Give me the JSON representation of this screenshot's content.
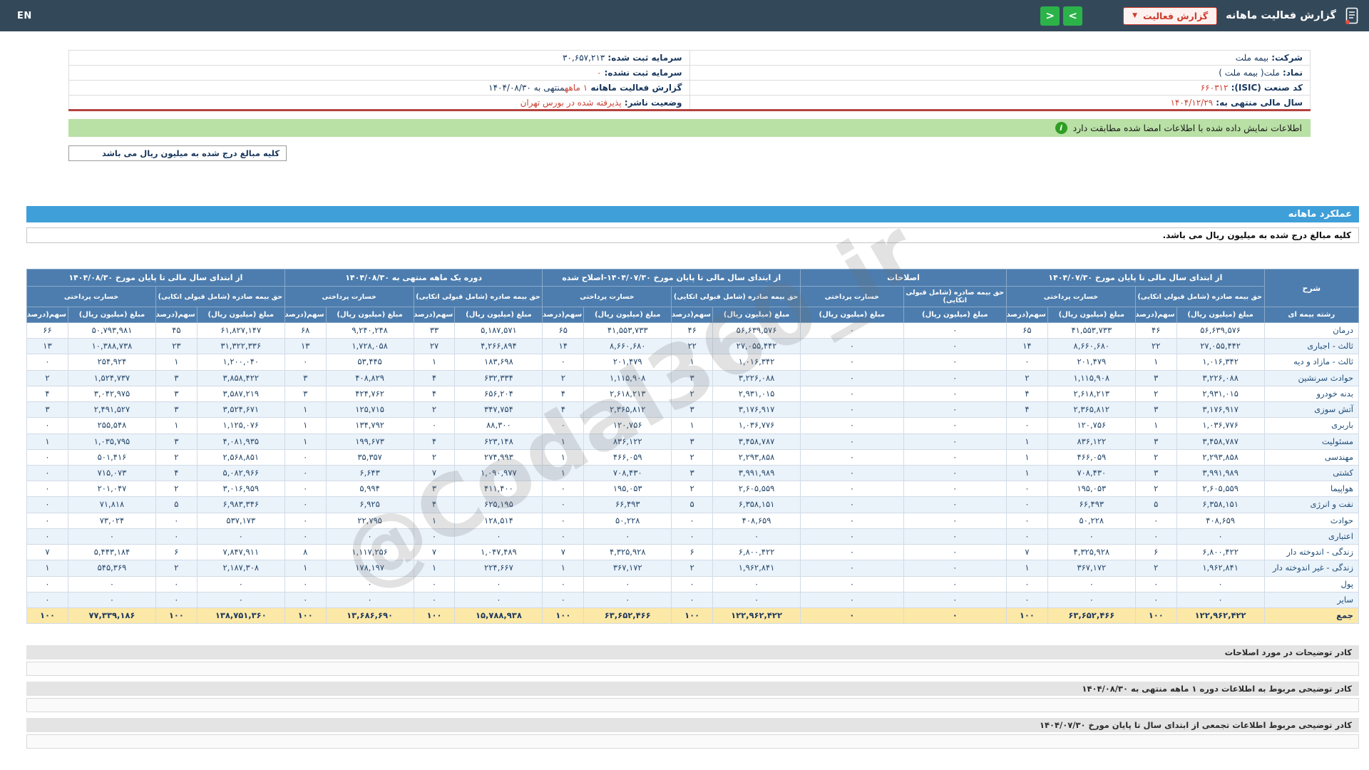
{
  "topbar": {
    "title": "گزارش فعالیت ماهانه",
    "dropdown_label": "گزارش فعالیت",
    "nav_next": ">",
    "nav_prev": "<",
    "en_label": "EN"
  },
  "company_info": {
    "rows": [
      {
        "right": {
          "label": "شرکت:",
          "value": "بیمه ملت",
          "red": false
        },
        "left": {
          "label": "سرمایه ثبت شده:",
          "value": "۳۰,۶۵۷,۲۱۳",
          "red": false
        }
      },
      {
        "right": {
          "label": "نماد:",
          "value": "ملت( بیمه ملت )",
          "red": false
        },
        "left": {
          "label": "سرمایه ثبت نشده:",
          "value": "۰",
          "red": true
        }
      },
      {
        "right": {
          "label": "کد صنعت (ISIC):",
          "value": "۶۶۰۳۱۲",
          "red": true
        },
        "left": {
          "label": "گزارش فعالیت ماهانه",
          "value": "۱ ماهه",
          "suffix": "منتهی به ۱۴۰۴/۰۸/۳۰",
          "red": true
        }
      },
      {
        "right": {
          "label": "سال مالی منتهی به:",
          "value": "۱۴۰۴/۱۲/۲۹",
          "red": true
        },
        "left": {
          "label": "وضعیت ناشر:",
          "value": "پذیرفته شده در بورس تهران",
          "red": true
        }
      }
    ]
  },
  "notice": {
    "text": "اطلاعات نمایش داده شده با اطلاعات امضا شده مطابقت دارد",
    "icon": "i"
  },
  "units_box": "کلیه مبالغ درج شده به میلیون ریال می باشد",
  "section": {
    "title": "عملکرد ماهانه",
    "units_note": "کلیه مبالغ درج شده به میلیون ریال می باشد."
  },
  "table": {
    "headers": {
      "desc": "شرح",
      "line": "رشته بیمه ای",
      "group_ytd_old": "از ابتدای سال مالی تا پایان مورخ ۱۴۰۴/۰۷/۳۰",
      "group_adjustments": "اصلاحات",
      "group_ytd_adjusted": "از ابتدای سال مالی تا پایان مورخ ۱۴۰۴/۰۷/۳۰-اصلاح شده",
      "group_month": "دوره یک ماهه منتهی به ۱۴۰۴/۰۸/۳۰",
      "group_ytd_new": "از ابتدای سال مالی تا پایان مورخ ۱۴۰۴/۰۸/۳۰",
      "sub_premium": "حق بیمه صادره (شامل قبولی اتکایی)",
      "sub_claims": "خسارت پرداختی",
      "leaf_amount": "مبلغ (میلیون ریال)",
      "leaf_share": "سهم(درصد)"
    },
    "rows": [
      {
        "name": "درمان",
        "cells": [
          "۵۶,۶۳۹,۵۷۶",
          "۴۶",
          "۴۱,۵۵۳,۷۳۳",
          "۶۵",
          "۰",
          "۰",
          "۵۶,۶۳۹,۵۷۶",
          "۴۶",
          "۴۱,۵۵۳,۷۳۳",
          "۶۵",
          "۵,۱۸۷,۵۷۱",
          "۳۳",
          "۹,۲۴۰,۲۴۸",
          "۶۸",
          "۶۱,۸۲۷,۱۴۷",
          "۴۵",
          "۵۰,۷۹۳,۹۸۱",
          "۶۶"
        ]
      },
      {
        "name": "ثالث - اجباری",
        "cells": [
          "۲۷,۰۵۵,۴۴۲",
          "۲۲",
          "۸,۶۶۰,۶۸۰",
          "۱۴",
          "۰",
          "۰",
          "۲۷,۰۵۵,۴۴۲",
          "۲۲",
          "۸,۶۶۰,۶۸۰",
          "۱۴",
          "۴,۲۶۶,۸۹۴",
          "۲۷",
          "۱,۷۲۸,۰۵۸",
          "۱۳",
          "۳۱,۳۲۲,۳۳۶",
          "۲۳",
          "۱۰,۳۸۸,۷۳۸",
          "۱۳"
        ]
      },
      {
        "name": "ثالث - مازاد و دیه",
        "cells": [
          "۱,۰۱۶,۳۴۲",
          "۱",
          "۲۰۱,۴۷۹",
          "۰",
          "۰",
          "۰",
          "۱,۰۱۶,۳۴۲",
          "۱",
          "۲۰۱,۴۷۹",
          "۰",
          "۱۸۳,۶۹۸",
          "۱",
          "۵۳,۴۴۵",
          "۰",
          "۱,۲۰۰,۰۴۰",
          "۱",
          "۲۵۴,۹۲۴",
          "۰"
        ]
      },
      {
        "name": "حوادث سرنشین",
        "cells": [
          "۳,۲۲۶,۰۸۸",
          "۳",
          "۱,۱۱۵,۹۰۸",
          "۲",
          "۰",
          "۰",
          "۳,۲۲۶,۰۸۸",
          "۳",
          "۱,۱۱۵,۹۰۸",
          "۲",
          "۶۳۲,۳۳۴",
          "۴",
          "۴۰۸,۸۲۹",
          "۳",
          "۳,۸۵۸,۴۲۲",
          "۳",
          "۱,۵۲۴,۷۳۷",
          "۲"
        ]
      },
      {
        "name": "بدنه خودرو",
        "cells": [
          "۲,۹۳۱,۰۱۵",
          "۲",
          "۲,۶۱۸,۲۱۳",
          "۴",
          "۰",
          "۰",
          "۲,۹۳۱,۰۱۵",
          "۲",
          "۲,۶۱۸,۲۱۳",
          "۴",
          "۶۵۶,۲۰۴",
          "۴",
          "۴۲۴,۷۶۲",
          "۳",
          "۳,۵۸۷,۲۱۹",
          "۳",
          "۳,۰۴۲,۹۷۵",
          "۴"
        ]
      },
      {
        "name": "آتش سوزی",
        "cells": [
          "۳,۱۷۶,۹۱۷",
          "۳",
          "۲,۳۶۵,۸۱۲",
          "۴",
          "۰",
          "۰",
          "۳,۱۷۶,۹۱۷",
          "۳",
          "۲,۳۶۵,۸۱۲",
          "۴",
          "۳۴۷,۷۵۴",
          "۲",
          "۱۲۵,۷۱۵",
          "۱",
          "۳,۵۲۴,۶۷۱",
          "۳",
          "۲,۴۹۱,۵۲۷",
          "۳"
        ]
      },
      {
        "name": "باربری",
        "cells": [
          "۱,۰۳۶,۷۷۶",
          "۱",
          "۱۲۰,۷۵۶",
          "۰",
          "۰",
          "۰",
          "۱,۰۳۶,۷۷۶",
          "۱",
          "۱۲۰,۷۵۶",
          "۰",
          "۸۸,۳۰۰",
          "۰",
          "۱۳۴,۷۹۲",
          "۱",
          "۱,۱۲۵,۰۷۶",
          "۱",
          "۲۵۵,۵۴۸",
          "۰"
        ]
      },
      {
        "name": "مسئولیت",
        "cells": [
          "۳,۴۵۸,۷۸۷",
          "۳",
          "۸۳۶,۱۲۲",
          "۱",
          "۰",
          "۰",
          "۳,۴۵۸,۷۸۷",
          "۳",
          "۸۳۶,۱۲۲",
          "۱",
          "۶۲۳,۱۴۸",
          "۴",
          "۱۹۹,۶۷۳",
          "۱",
          "۴,۰۸۱,۹۳۵",
          "۳",
          "۱,۰۳۵,۷۹۵",
          "۱"
        ]
      },
      {
        "name": "مهندسی",
        "cells": [
          "۲,۲۹۳,۸۵۸",
          "۲",
          "۴۶۶,۰۵۹",
          "۱",
          "۰",
          "۰",
          "۲,۲۹۳,۸۵۸",
          "۲",
          "۴۶۶,۰۵۹",
          "۱",
          "۲۷۴,۹۹۳",
          "۲",
          "۳۵,۳۵۷",
          "۰",
          "۲,۵۶۸,۸۵۱",
          "۲",
          "۵۰۱,۴۱۶",
          "۰"
        ]
      },
      {
        "name": "کشتی",
        "cells": [
          "۳,۹۹۱,۹۸۹",
          "۳",
          "۷۰۸,۴۳۰",
          "۱",
          "۰",
          "۰",
          "۳,۹۹۱,۹۸۹",
          "۳",
          "۷۰۸,۴۳۰",
          "۱",
          "۱,۰۹۰,۹۷۷",
          "۷",
          "۶,۶۴۳",
          "۰",
          "۵,۰۸۲,۹۶۶",
          "۴",
          "۷۱۵,۰۷۳",
          "۰"
        ]
      },
      {
        "name": "هواپیما",
        "cells": [
          "۲,۶۰۵,۵۵۹",
          "۲",
          "۱۹۵,۰۵۳",
          "۰",
          "۰",
          "۰",
          "۲,۶۰۵,۵۵۹",
          "۲",
          "۱۹۵,۰۵۳",
          "۰",
          "۴۱۱,۴۰۰",
          "۳",
          "۵,۹۹۴",
          "۰",
          "۳,۰۱۶,۹۵۹",
          "۲",
          "۲۰۱,۰۴۷",
          "۰"
        ]
      },
      {
        "name": "نفت و انرژی",
        "cells": [
          "۶,۳۵۸,۱۵۱",
          "۵",
          "۶۶,۴۹۳",
          "۰",
          "۰",
          "۰",
          "۶,۳۵۸,۱۵۱",
          "۵",
          "۶۶,۴۹۳",
          "۰",
          "۶۲۵,۱۹۵",
          "۴",
          "۶,۹۲۵",
          "۰",
          "۶,۹۸۳,۳۴۶",
          "۵",
          "۷۱,۸۱۸",
          "۰"
        ]
      },
      {
        "name": "حوادث",
        "cells": [
          "۴۰۸,۶۵۹",
          "۰",
          "۵۰,۲۲۸",
          "۰",
          "۰",
          "۰",
          "۴۰۸,۶۵۹",
          "۰",
          "۵۰,۲۲۸",
          "۰",
          "۱۲۸,۵۱۴",
          "۱",
          "۲۲,۷۹۵",
          "۰",
          "۵۳۷,۱۷۳",
          "۰",
          "۷۳,۰۲۴",
          "۰"
        ]
      },
      {
        "name": "اعتباری",
        "cells": [
          "۰",
          "۰",
          "۰",
          "۰",
          "۰",
          "۰",
          "۰",
          "۰",
          "۰",
          "۰",
          "۰",
          "۰",
          "۰",
          "۰",
          "۰",
          "۰",
          "۰",
          "۰"
        ]
      },
      {
        "name": "زندگی - اندوخته دار",
        "cells": [
          "۶,۸۰۰,۴۲۲",
          "۶",
          "۴,۳۲۵,۹۲۸",
          "۷",
          "۰",
          "۰",
          "۶,۸۰۰,۴۲۲",
          "۶",
          "۴,۳۲۵,۹۲۸",
          "۷",
          "۱,۰۴۷,۴۸۹",
          "۷",
          "۱,۱۱۷,۲۵۶",
          "۸",
          "۷,۸۴۷,۹۱۱",
          "۶",
          "۵,۴۴۳,۱۸۴",
          "۷"
        ]
      },
      {
        "name": "زندگی - غیر اندوخته دار",
        "cells": [
          "۱,۹۶۲,۸۴۱",
          "۲",
          "۳۶۷,۱۷۲",
          "۱",
          "۰",
          "۰",
          "۱,۹۶۲,۸۴۱",
          "۲",
          "۳۶۷,۱۷۲",
          "۱",
          "۲۲۴,۶۶۷",
          "۱",
          "۱۷۸,۱۹۷",
          "۱",
          "۲,۱۸۷,۳۰۸",
          "۲",
          "۵۴۵,۳۶۹",
          "۱"
        ]
      },
      {
        "name": "پول",
        "cells": [
          "۰",
          "۰",
          "۰",
          "۰",
          "۰",
          "۰",
          "۰",
          "۰",
          "۰",
          "۰",
          "۰",
          "۰",
          "۰",
          "۰",
          "۰",
          "۰",
          "۰",
          "۰"
        ]
      },
      {
        "name": "سایر",
        "cells": [
          "۰",
          "۰",
          "۰",
          "۰",
          "۰",
          "۰",
          "۰",
          "۰",
          "۰",
          "۰",
          "۰",
          "۰",
          "۰",
          "۰",
          "۰",
          "۰",
          "۰",
          "۰"
        ]
      },
      {
        "name": "جمع",
        "total": true,
        "cells": [
          "۱۲۲,۹۶۲,۴۲۲",
          "۱۰۰",
          "۶۳,۶۵۲,۴۶۶",
          "۱۰۰",
          "۰",
          "۰",
          "۱۲۲,۹۶۲,۴۲۲",
          "۱۰۰",
          "۶۳,۶۵۲,۴۶۶",
          "۱۰۰",
          "۱۵,۷۸۸,۹۳۸",
          "۱۰۰",
          "۱۳,۶۸۶,۶۹۰",
          "۱۰۰",
          "۱۳۸,۷۵۱,۳۶۰",
          "۱۰۰",
          "۷۷,۳۳۹,۱۸۶",
          "۱۰۰"
        ]
      }
    ]
  },
  "footnotes": [
    "کادر توضیحات در مورد اصلاحات",
    "کادر توضیحی مربوط به اطلاعات دوره ۱ ماهه منتهی به ۱۴۰۴/۰۸/۳۰",
    "کادر توضیحی مربوط اطلاعات تجمعی از ابتدای سال تا پایان مورخ ۱۴۰۴/۰۷/۳۰"
  ],
  "watermark": "@Codal360_ir",
  "colors": {
    "topbar": "#33495a",
    "table_header_blue": "#4d7dae",
    "section_band_blue": "#3f9fd8",
    "total_row_yellow": "#fce8a7",
    "notice_green": "#b9e0a5",
    "red_accent": "#cf3a2c",
    "green_accent": "#2bb34a"
  }
}
